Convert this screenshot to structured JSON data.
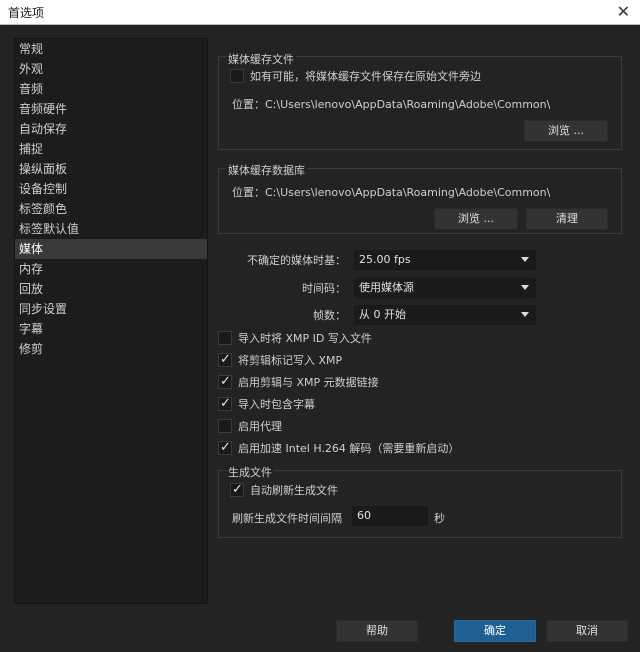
{
  "window": {
    "title": "首选项",
    "close_glyph": "✕"
  },
  "sidebar": {
    "items": [
      {
        "label": "常规"
      },
      {
        "label": "外观"
      },
      {
        "label": "音频"
      },
      {
        "label": "音频硬件"
      },
      {
        "label": "自动保存"
      },
      {
        "label": "捕捉"
      },
      {
        "label": "操纵面板"
      },
      {
        "label": "设备控制"
      },
      {
        "label": "标签颜色"
      },
      {
        "label": "标签默认值"
      },
      {
        "label": "媒体",
        "selected": true
      },
      {
        "label": "内存"
      },
      {
        "label": "回放"
      },
      {
        "label": "同步设置"
      },
      {
        "label": "字幕"
      },
      {
        "label": "修剪"
      }
    ]
  },
  "media_cache_files": {
    "title": "媒体缓存文件",
    "save_next_to_original_label": "如有可能，将媒体缓存文件保存在原始文件旁边",
    "save_next_to_original_checked": false,
    "location_label": "位置：C:\\Users\\lenovo\\AppData\\Roaming\\Adobe\\Common\\",
    "browse_label": "浏览 ..."
  },
  "media_cache_db": {
    "title": "媒体缓存数据库",
    "location_label": "位置：C:\\Users\\lenovo\\AppData\\Roaming\\Adobe\\Common\\",
    "browse_label": "浏览 ...",
    "clean_label": "清理"
  },
  "settings": {
    "timebase_label": "不确定的媒体时基：",
    "timebase_value": "25.00 fps",
    "timecode_label": "时间码：",
    "timecode_value": "使用媒体源",
    "frame_label": "帧数：",
    "frame_value": "从 0 开始"
  },
  "checkboxes": [
    {
      "label": "导入时将 XMP ID 写入文件",
      "checked": false
    },
    {
      "label": "将剪辑标记写入 XMP",
      "checked": true
    },
    {
      "label": "启用剪辑与 XMP 元数据链接",
      "checked": true
    },
    {
      "label": "导入时包含字幕",
      "checked": true
    },
    {
      "label": "启用代理",
      "checked": false
    },
    {
      "label": "启用加速 Intel H.264 解码（需要重新启动）",
      "checked": true
    }
  ],
  "growing_files": {
    "title": "生成文件",
    "auto_refresh_label": "自动刷新生成文件",
    "auto_refresh_checked": true,
    "interval_label": "刷新生成文件时间间隔",
    "interval_value": "60",
    "interval_unit": "秒"
  },
  "footer": {
    "help_label": "帮助",
    "ok_label": "确定",
    "cancel_label": "取消"
  }
}
